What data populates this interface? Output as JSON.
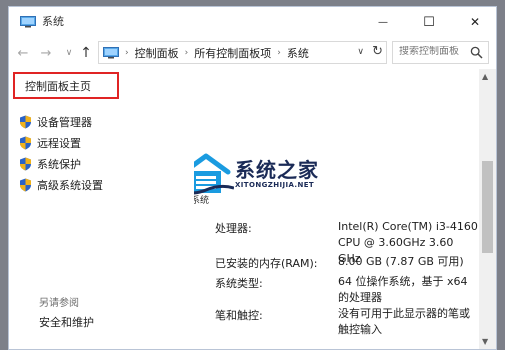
{
  "window": {
    "title": "系统"
  },
  "title_buttons": {
    "minimize_glyph": "—",
    "maximize_glyph": "☐",
    "close_glyph": "✕"
  },
  "address_bar": {
    "crumbs": [
      "控制面板",
      "所有控制面板项",
      "系统"
    ],
    "separator_glyph": "›",
    "search_placeholder": "搜索控制面板"
  },
  "left_pane": {
    "home_link": "控制面板主页",
    "links": [
      "设备管理器",
      "远程设置",
      "系统保护",
      "高级系统设置"
    ],
    "see_also_header": "另请参阅",
    "see_also_links": [
      "安全和维护"
    ]
  },
  "main": {
    "watermark_title": "系统之家",
    "watermark_subtitle": "XITONGZHIJIA.NET",
    "section_label": "系统",
    "specs": [
      {
        "label": "处理器:",
        "value": "Intel(R) Core(TM) i3-4160 CPU @ 3.60GHz   3.60 GHz"
      },
      {
        "label": "已安装的内存(RAM):",
        "value": "8.00 GB (7.87 GB 可用)"
      },
      {
        "label": "系统类型:",
        "value": "64 位操作系统，基于 x64 的处理器"
      },
      {
        "label": "笔和触控:",
        "value": "没有可用于此显示器的笔或触控输入"
      }
    ]
  },
  "icons": {
    "window_icon": "computer-icon",
    "link_icon": "shield-icon",
    "back": "arrow-left-icon",
    "forward": "arrow-right-icon",
    "up": "arrow-up-icon",
    "refresh": "refresh-icon",
    "search": "search-icon"
  },
  "colors": {
    "highlight_border": "#e02424",
    "watermark_blue": "#1b2b57",
    "watermark_accent": "#1a9be0",
    "shield_blue": "#2a63c8",
    "shield_gold": "#f0b21c"
  }
}
